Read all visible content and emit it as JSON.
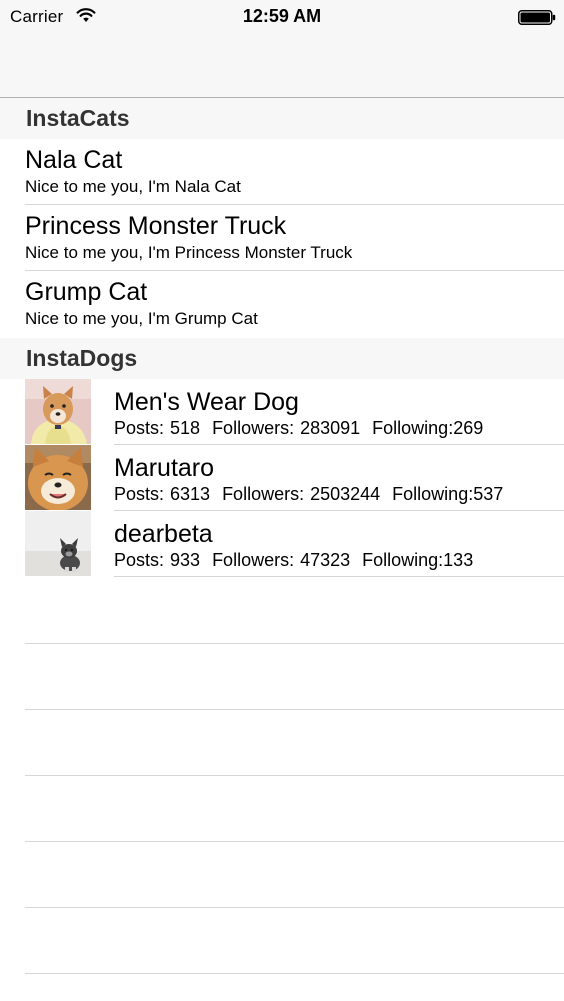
{
  "status_bar": {
    "carrier": "Carrier",
    "time": "12:59 AM",
    "wifi_icon": "wifi-icon",
    "battery_icon": "battery-icon"
  },
  "sections": [
    {
      "title": "InstaCats",
      "rows": [
        {
          "name": "Nala Cat",
          "subtitle": "Nice to me you, I'm Nala Cat"
        },
        {
          "name": "Princess Monster Truck",
          "subtitle": "Nice to me you, I'm Princess Monster Truck"
        },
        {
          "name": "Grump Cat",
          "subtitle": "Nice to me you, I'm Grump Cat"
        }
      ]
    },
    {
      "title": "InstaDogs",
      "rows": [
        {
          "name": "Men's Wear Dog",
          "posts": "Posts: 518",
          "followers": "Followers: 283091",
          "following": "Following:269",
          "avatar": "shiba-in-sweater-photo"
        },
        {
          "name": "Marutaro",
          "posts": "Posts: 6313",
          "followers": "Followers: 2503244",
          "following": "Following:537",
          "avatar": "shiba-face-photo"
        },
        {
          "name": "dearbeta",
          "posts": "Posts: 933",
          "followers": "Followers: 47323",
          "following": "Following:133",
          "avatar": "french-bulldog-photo"
        }
      ]
    }
  ],
  "colors": {
    "bar_background": "#f7f7f7",
    "separator": "#d6d6d9",
    "section_title": "#333333"
  }
}
